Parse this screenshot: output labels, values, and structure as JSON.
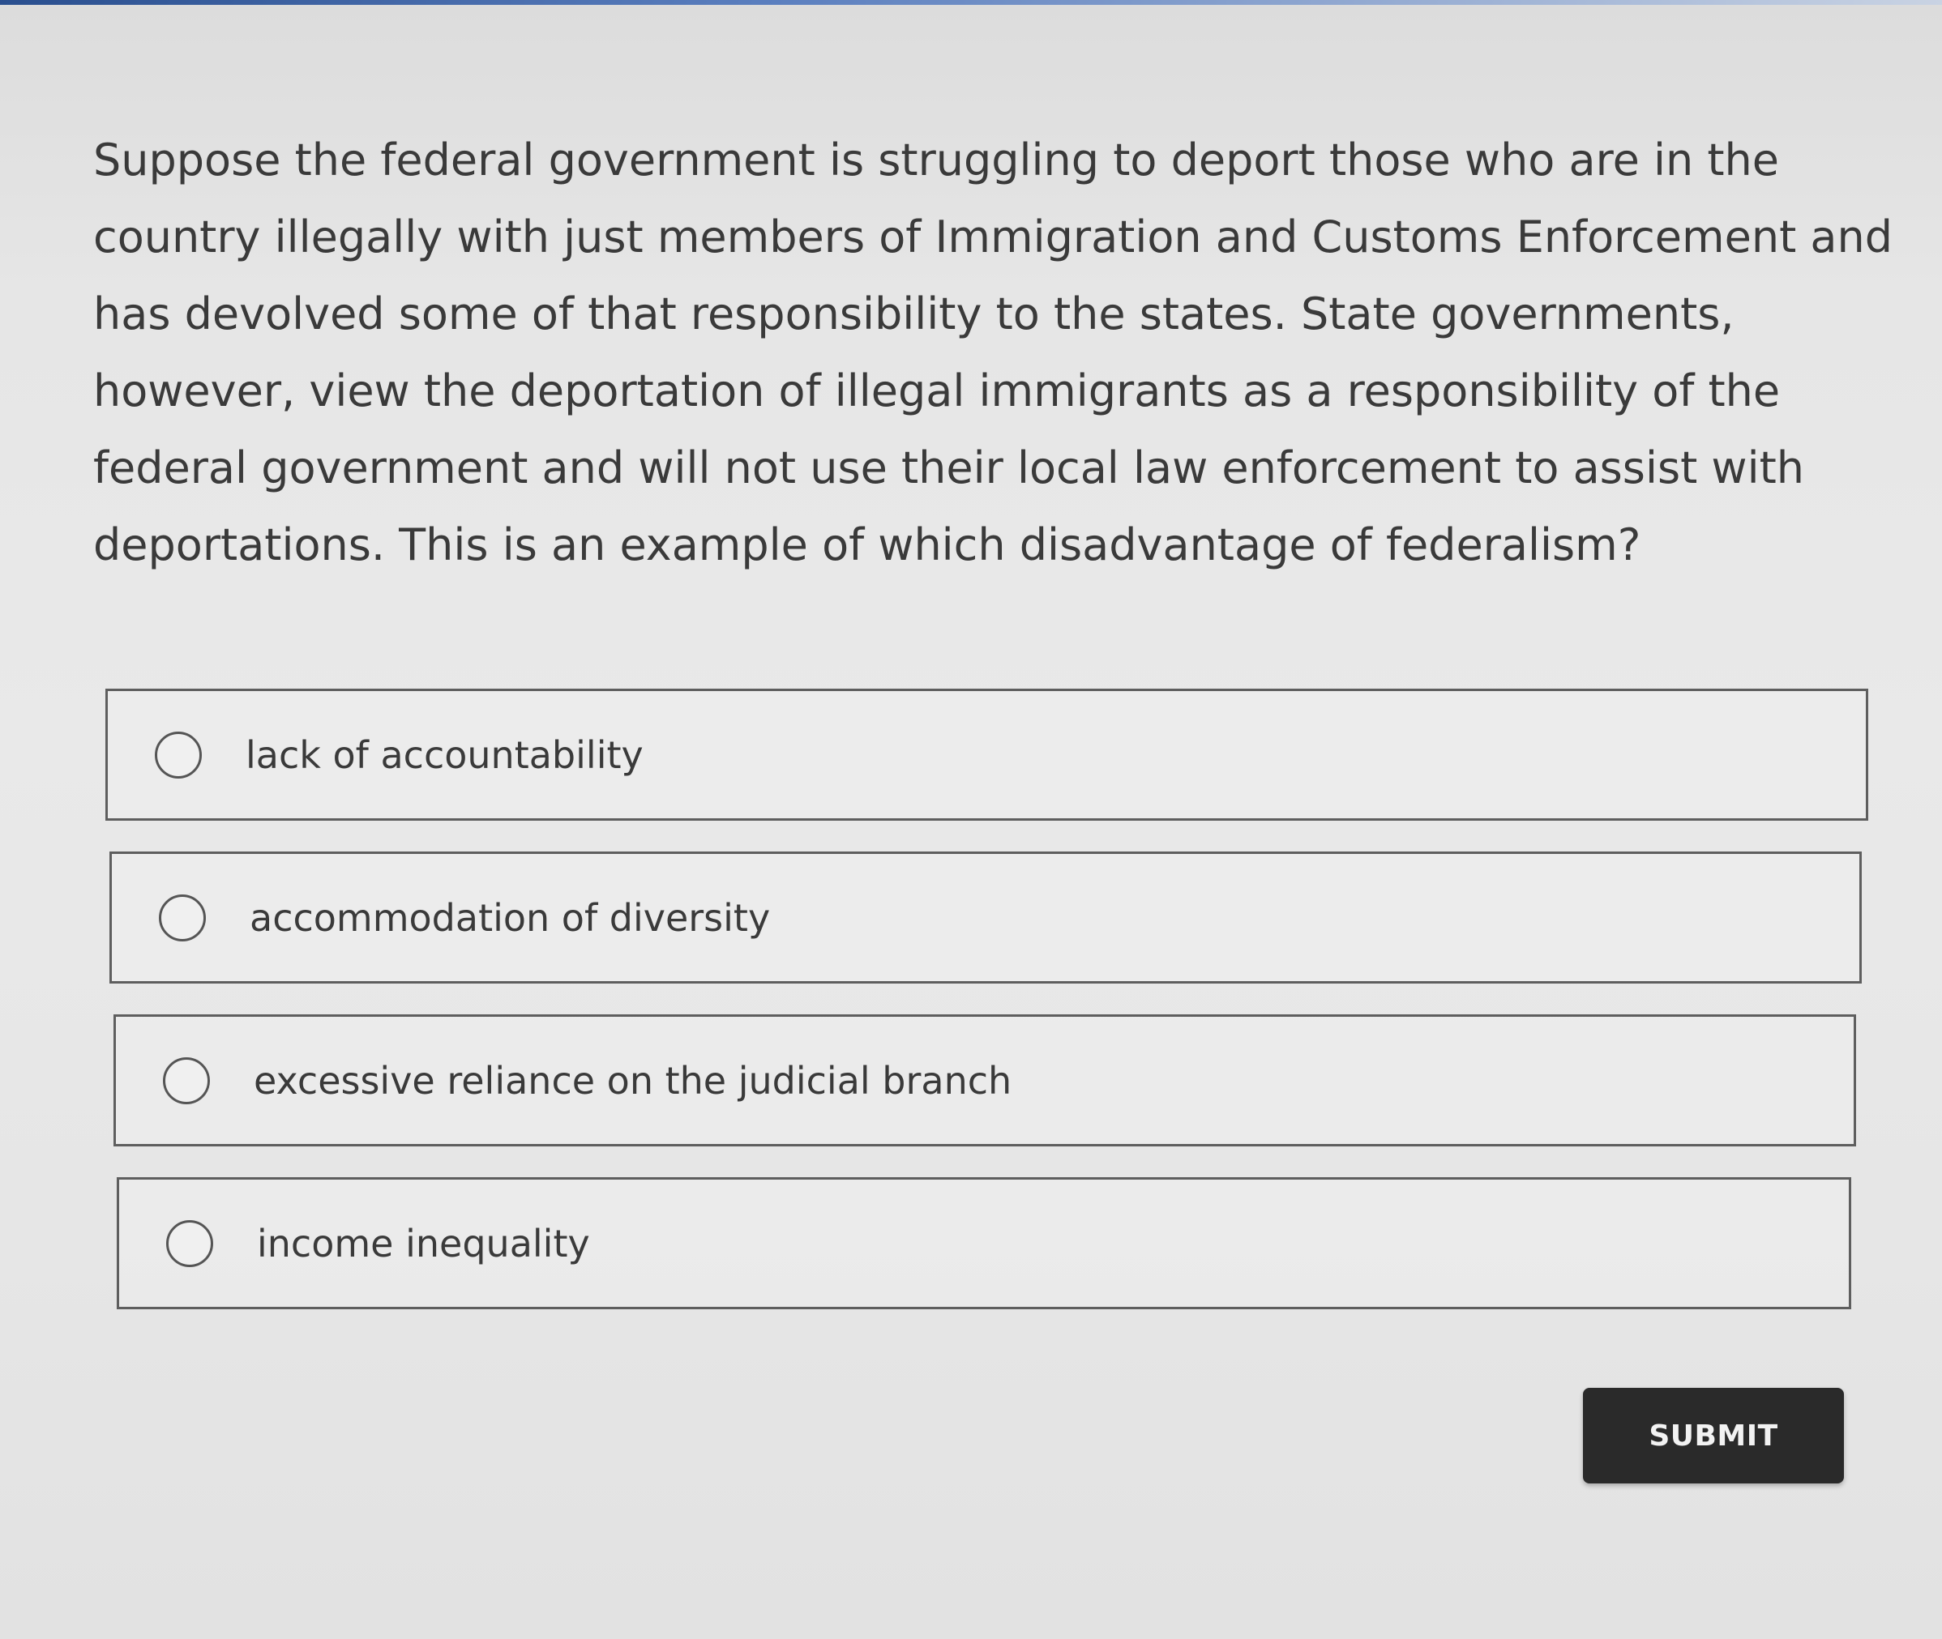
{
  "question": {
    "text": "Suppose the federal government is struggling to deport those who are in the country illegally with just members of Immigration and Customs Enforcement and has devolved some of that responsibility to the states. State governments, however, view the deportation of illegal immigrants as a responsibility of the federal government and will not use their local law enforcement to assist with deportations. This is an example of which disadvantage of federalism?"
  },
  "options": [
    {
      "label": "lack of accountability",
      "selected": false
    },
    {
      "label": "accommodation of diversity",
      "selected": false
    },
    {
      "label": "excessive reliance on the judicial branch",
      "selected": false
    },
    {
      "label": "income inequality",
      "selected": false
    }
  ],
  "submit": {
    "label": "SUBMIT"
  },
  "colors": {
    "background": "#e8e8e8",
    "submit_button": "#2a2a2a",
    "option_border": "#5e5e5e"
  }
}
